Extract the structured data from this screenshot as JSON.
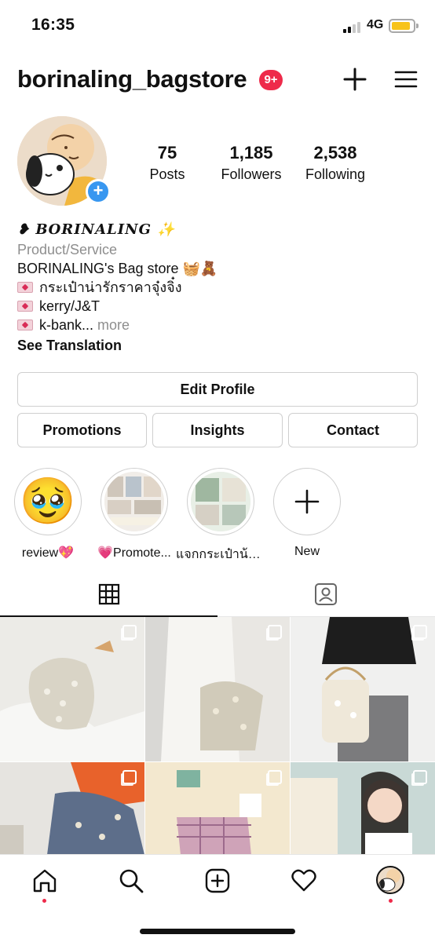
{
  "status_bar": {
    "time": "16:35",
    "network": "4G"
  },
  "header": {
    "username": "borinaling_bagstore",
    "notification_badge": "9+"
  },
  "stats": [
    {
      "value": "75",
      "label": "Posts"
    },
    {
      "value": "1,185",
      "label": "Followers"
    },
    {
      "value": "2,538",
      "label": "Following"
    }
  ],
  "bio": {
    "name": "❥ 𝑩𝑶𝑹𝑰𝑵𝑨𝑳𝑰𝑵𝑮 ✨",
    "category": "Product/Service",
    "line1": "BORINALING's Bag store 🧺🧸",
    "line2": "กระเป๋าน่ารักราคาจุ๋งจิ๋ง",
    "line3": "kerry/J&T",
    "line4": "k-bank...",
    "more": " more",
    "see_translation": "See Translation"
  },
  "buttons": {
    "edit_profile": "Edit Profile",
    "promotions": "Promotions",
    "insights": "Insights",
    "contact": "Contact"
  },
  "highlights": [
    {
      "label": "review💖",
      "thumb": "🥹"
    },
    {
      "label": "💗Promote..."
    },
    {
      "label": "แจกกระเป๋าน้อง..."
    },
    {
      "label": "New"
    }
  ],
  "tabs": [
    {
      "name": "grid",
      "active": true
    },
    {
      "name": "tagged",
      "active": false
    }
  ],
  "colors": {
    "accent_blue": "#3897f0",
    "badge_red": "#ee2a4a",
    "battery_yellow": "#f7c31a",
    "muted_text": "#8e8e8e"
  }
}
